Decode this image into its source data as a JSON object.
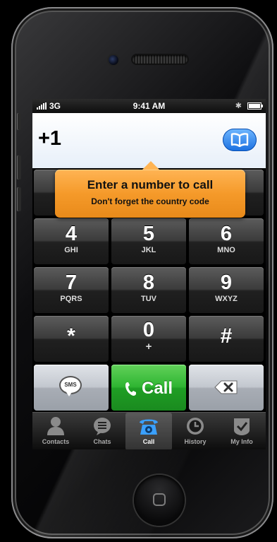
{
  "status_bar": {
    "carrier": "3G",
    "time": "9:41 AM"
  },
  "dialer": {
    "number": "+1"
  },
  "tooltip": {
    "title": "Enter a number to call",
    "subtitle": "Don't forget the country code"
  },
  "keypad": {
    "keys": [
      {
        "digit": "4",
        "letters": "GHI"
      },
      {
        "digit": "5",
        "letters": "JKL"
      },
      {
        "digit": "6",
        "letters": "MNO"
      },
      {
        "digit": "7",
        "letters": "PQRS"
      },
      {
        "digit": "8",
        "letters": "TUV"
      },
      {
        "digit": "9",
        "letters": "WXYZ"
      },
      {
        "digit": "*",
        "letters": ""
      },
      {
        "digit": "0",
        "letters": "+"
      },
      {
        "digit": "#",
        "letters": ""
      }
    ],
    "sms_label": "SMS",
    "call_label": "Call"
  },
  "tabs": [
    {
      "label": "Contacts",
      "icon": "person-icon"
    },
    {
      "label": "Chats",
      "icon": "chat-bubble-icon"
    },
    {
      "label": "Call",
      "icon": "rotary-phone-icon"
    },
    {
      "label": "History",
      "icon": "clock-icon"
    },
    {
      "label": "My Info",
      "icon": "info-icon"
    }
  ],
  "colors": {
    "call_green": "#2fb532",
    "tooltip_orange": "#f59a2a",
    "contacts_blue": "#1a6fe0"
  }
}
